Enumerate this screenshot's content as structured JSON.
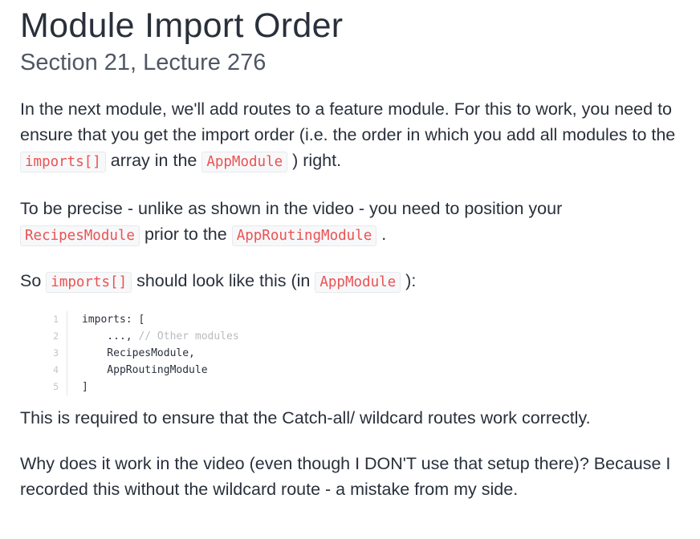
{
  "lecture": {
    "title": "Module Import Order",
    "subtitle": "Section 21, Lecture 276"
  },
  "paragraphs": {
    "p1": {
      "t1": "In the next module, we'll add routes to a feature module. For this to work, you need to ensure that you get the import order (i.e. the order in which you add all modules to the ",
      "c1": "imports[]",
      "t2": " array in the ",
      "c2": "AppModule",
      "t3": " ) right."
    },
    "p2": {
      "t1": "To be precise - unlike as shown in the video - you need to position your ",
      "c1": "RecipesModule",
      "t2": " prior to the ",
      "c2": "AppRoutingModule",
      "t3": " ."
    },
    "p3": {
      "t1": "So ",
      "c1": "imports[]",
      "t2": " should look like this (in ",
      "c2": "AppModule",
      "t3": " ):"
    },
    "p4": "This is required to ensure that the Catch-all/ wildcard routes work correctly.",
    "p5": "Why does it work in the video (even though I DON'T use that setup there)? Because I recorded this without the wildcard route - a mistake from my side."
  },
  "code_block": {
    "lines": [
      {
        "num": "1",
        "code": "imports: [",
        "comment": ""
      },
      {
        "num": "2",
        "code": "    ..., ",
        "comment": "// Other modules"
      },
      {
        "num": "3",
        "code": "    RecipesModule,",
        "comment": ""
      },
      {
        "num": "4",
        "code": "    AppRoutingModule",
        "comment": ""
      },
      {
        "num": "5",
        "code": "]",
        "comment": ""
      }
    ]
  },
  "colors": {
    "inline_code_text": "#ec5252",
    "body_text": "#29303b"
  }
}
